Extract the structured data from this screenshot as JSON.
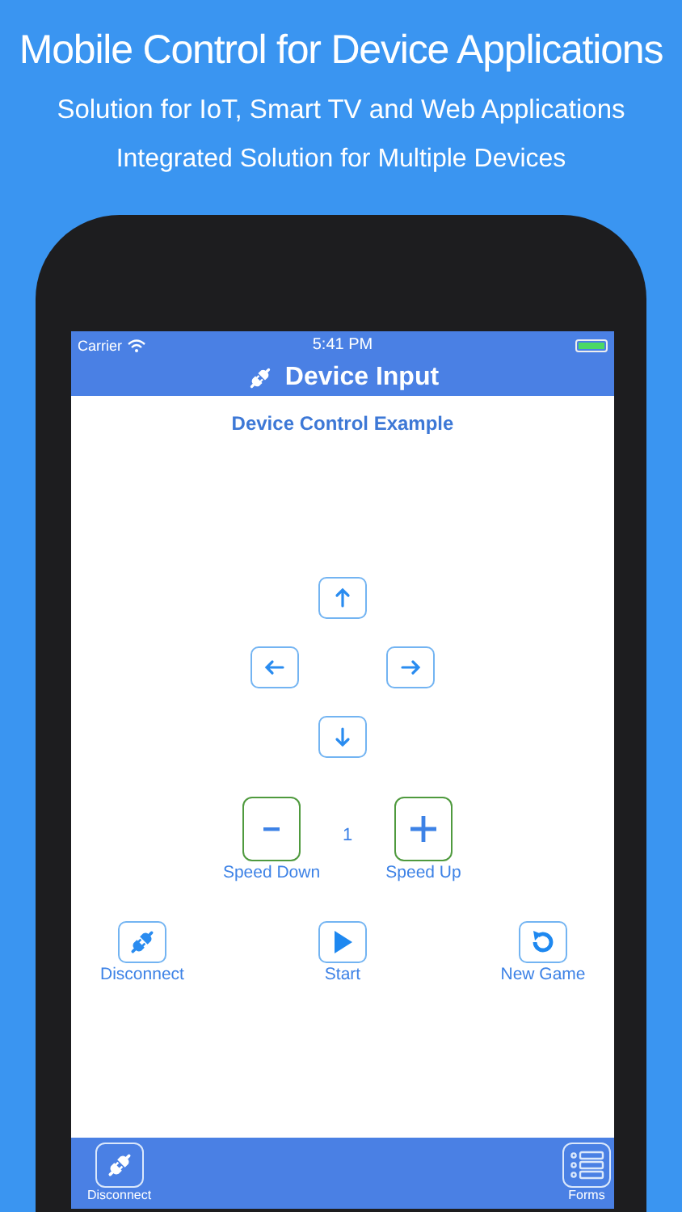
{
  "promo": {
    "headline": "Mobile Control for Device Applications",
    "subtitle": "Solution for IoT, Smart TV and Web Applications",
    "tagline": "Integrated Solution for Multiple Devices"
  },
  "status_bar": {
    "carrier": "Carrier",
    "time": "5:41 PM"
  },
  "nav_bar": {
    "title": "Device Input"
  },
  "content": {
    "title": "Device Control Example",
    "speed": {
      "value": "1",
      "decrease_label": "Speed Down",
      "increase_label": "Speed Up"
    },
    "actions": [
      {
        "kind": "disconnect",
        "label": "Disconnect"
      },
      {
        "kind": "start",
        "label": "Start"
      },
      {
        "kind": "new-game",
        "label": "New Game"
      }
    ]
  },
  "toolbar": [
    {
      "kind": "disconnect",
      "label": "Disconnect"
    },
    {
      "kind": "forms",
      "label": "Forms"
    }
  ]
}
